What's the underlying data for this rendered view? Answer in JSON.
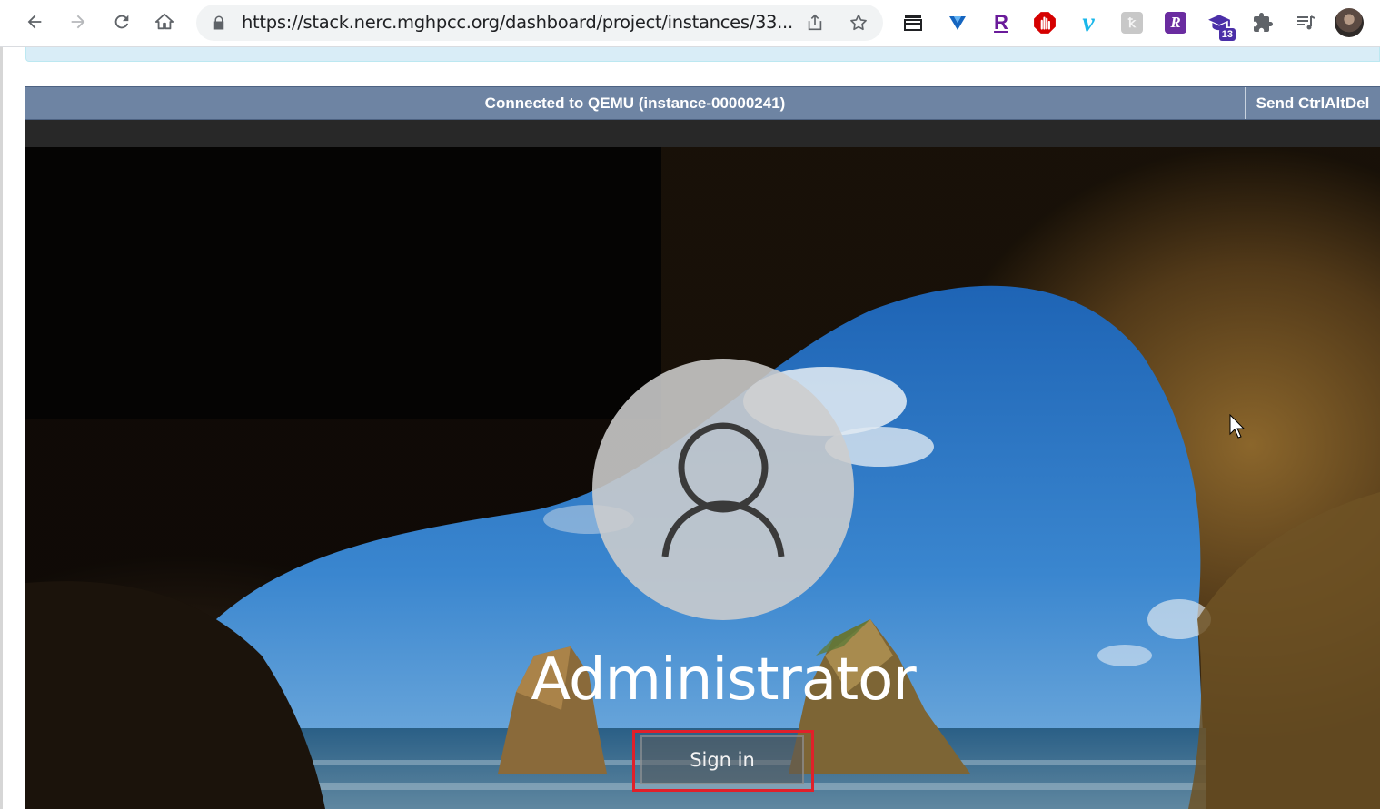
{
  "browser": {
    "url": "https://stack.nerc.mghpcc.org/dashboard/project/instances/33...",
    "nav": [
      "back-icon",
      "forward-icon",
      "reload-icon",
      "home-icon"
    ],
    "omnibox_icons": [
      "lock-icon",
      "share-icon",
      "bookmark-star-icon"
    ],
    "extensions": [
      {
        "name": "reading-list-icon",
        "label": ""
      },
      {
        "name": "extension-v-blue-icon",
        "label": ""
      },
      {
        "name": "extension-r-purple-icon",
        "label": "R"
      },
      {
        "name": "extension-stop-hand-icon",
        "label": ""
      },
      {
        "name": "vimeo-icon",
        "label": "v"
      },
      {
        "name": "extension-grey-icon",
        "label": ""
      },
      {
        "name": "extension-r-script-icon",
        "label": "R"
      },
      {
        "name": "graduation-cap-icon",
        "badge": "13"
      },
      {
        "name": "puzzle-icon",
        "label": ""
      },
      {
        "name": "media-queue-icon",
        "label": ""
      }
    ],
    "colors": {
      "toolbar": "#ffffff",
      "omnibox": "#f1f3f4"
    }
  },
  "vnc": {
    "status_text": "Connected to QEMU (instance-00000241)",
    "ctrl_alt_del_label": "Send CtrlAltDel",
    "colors": {
      "status_bar": "#6e84a3",
      "dark_bar": "#282828"
    }
  },
  "login": {
    "username": "Administrator",
    "sign_in_label": "Sign in",
    "highlight_color": "#e0202a"
  }
}
